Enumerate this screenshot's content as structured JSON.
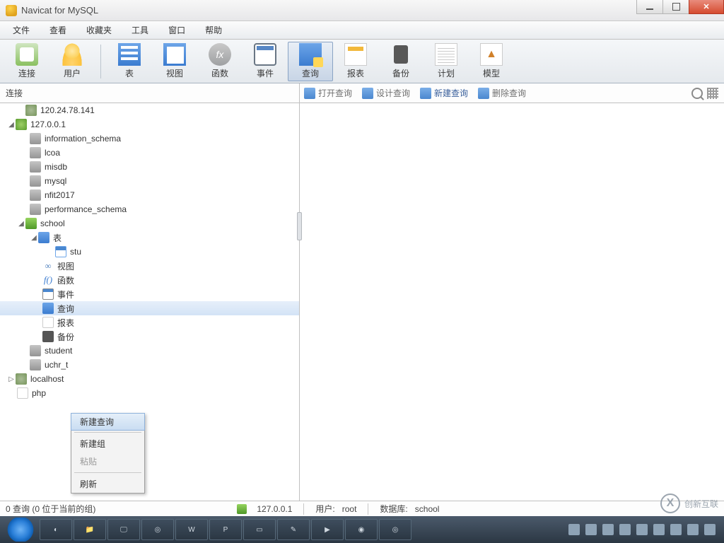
{
  "window": {
    "title": "Navicat for MySQL"
  },
  "menu": {
    "items": [
      "文件",
      "查看",
      "收藏夹",
      "工具",
      "窗口",
      "帮助"
    ]
  },
  "toolbar": {
    "connect": "连接",
    "user": "用户",
    "table": "表",
    "view": "视图",
    "func": "函数",
    "event": "事件",
    "query": "查询",
    "report": "报表",
    "backup": "备份",
    "plan": "计划",
    "model": "模型"
  },
  "subbar": {
    "left_label": "连接",
    "open_query": "打开查询",
    "design_query": "设计查询",
    "new_query": "新建查询",
    "delete_query": "删除查询"
  },
  "tree": {
    "server1": "120.24.78.141",
    "server2": "127.0.0.1",
    "db1": "information_schema",
    "db2": "lcoa",
    "db3": "misdb",
    "db4": "mysql",
    "db5": "nfit2017",
    "db6": "performance_schema",
    "db7": "school",
    "tables": "表",
    "stu": "stu",
    "views": "视图",
    "funcs": "函数",
    "events": "事件",
    "queries": "查询",
    "reports": "报表",
    "backups": "备份",
    "db8": "student",
    "db9": "uchr_t",
    "server3": "localhost",
    "php": "php"
  },
  "ctx": {
    "new_query": "新建查询",
    "new_group": "新建组",
    "paste": "粘贴",
    "refresh": "刷新"
  },
  "status": {
    "left": "0 查询 (0 位于当前的组)",
    "conn": "127.0.0.1",
    "user_label": "用户: ",
    "user": "root",
    "db_label": "数据库: ",
    "db": "school"
  },
  "watermark": "创新互联"
}
